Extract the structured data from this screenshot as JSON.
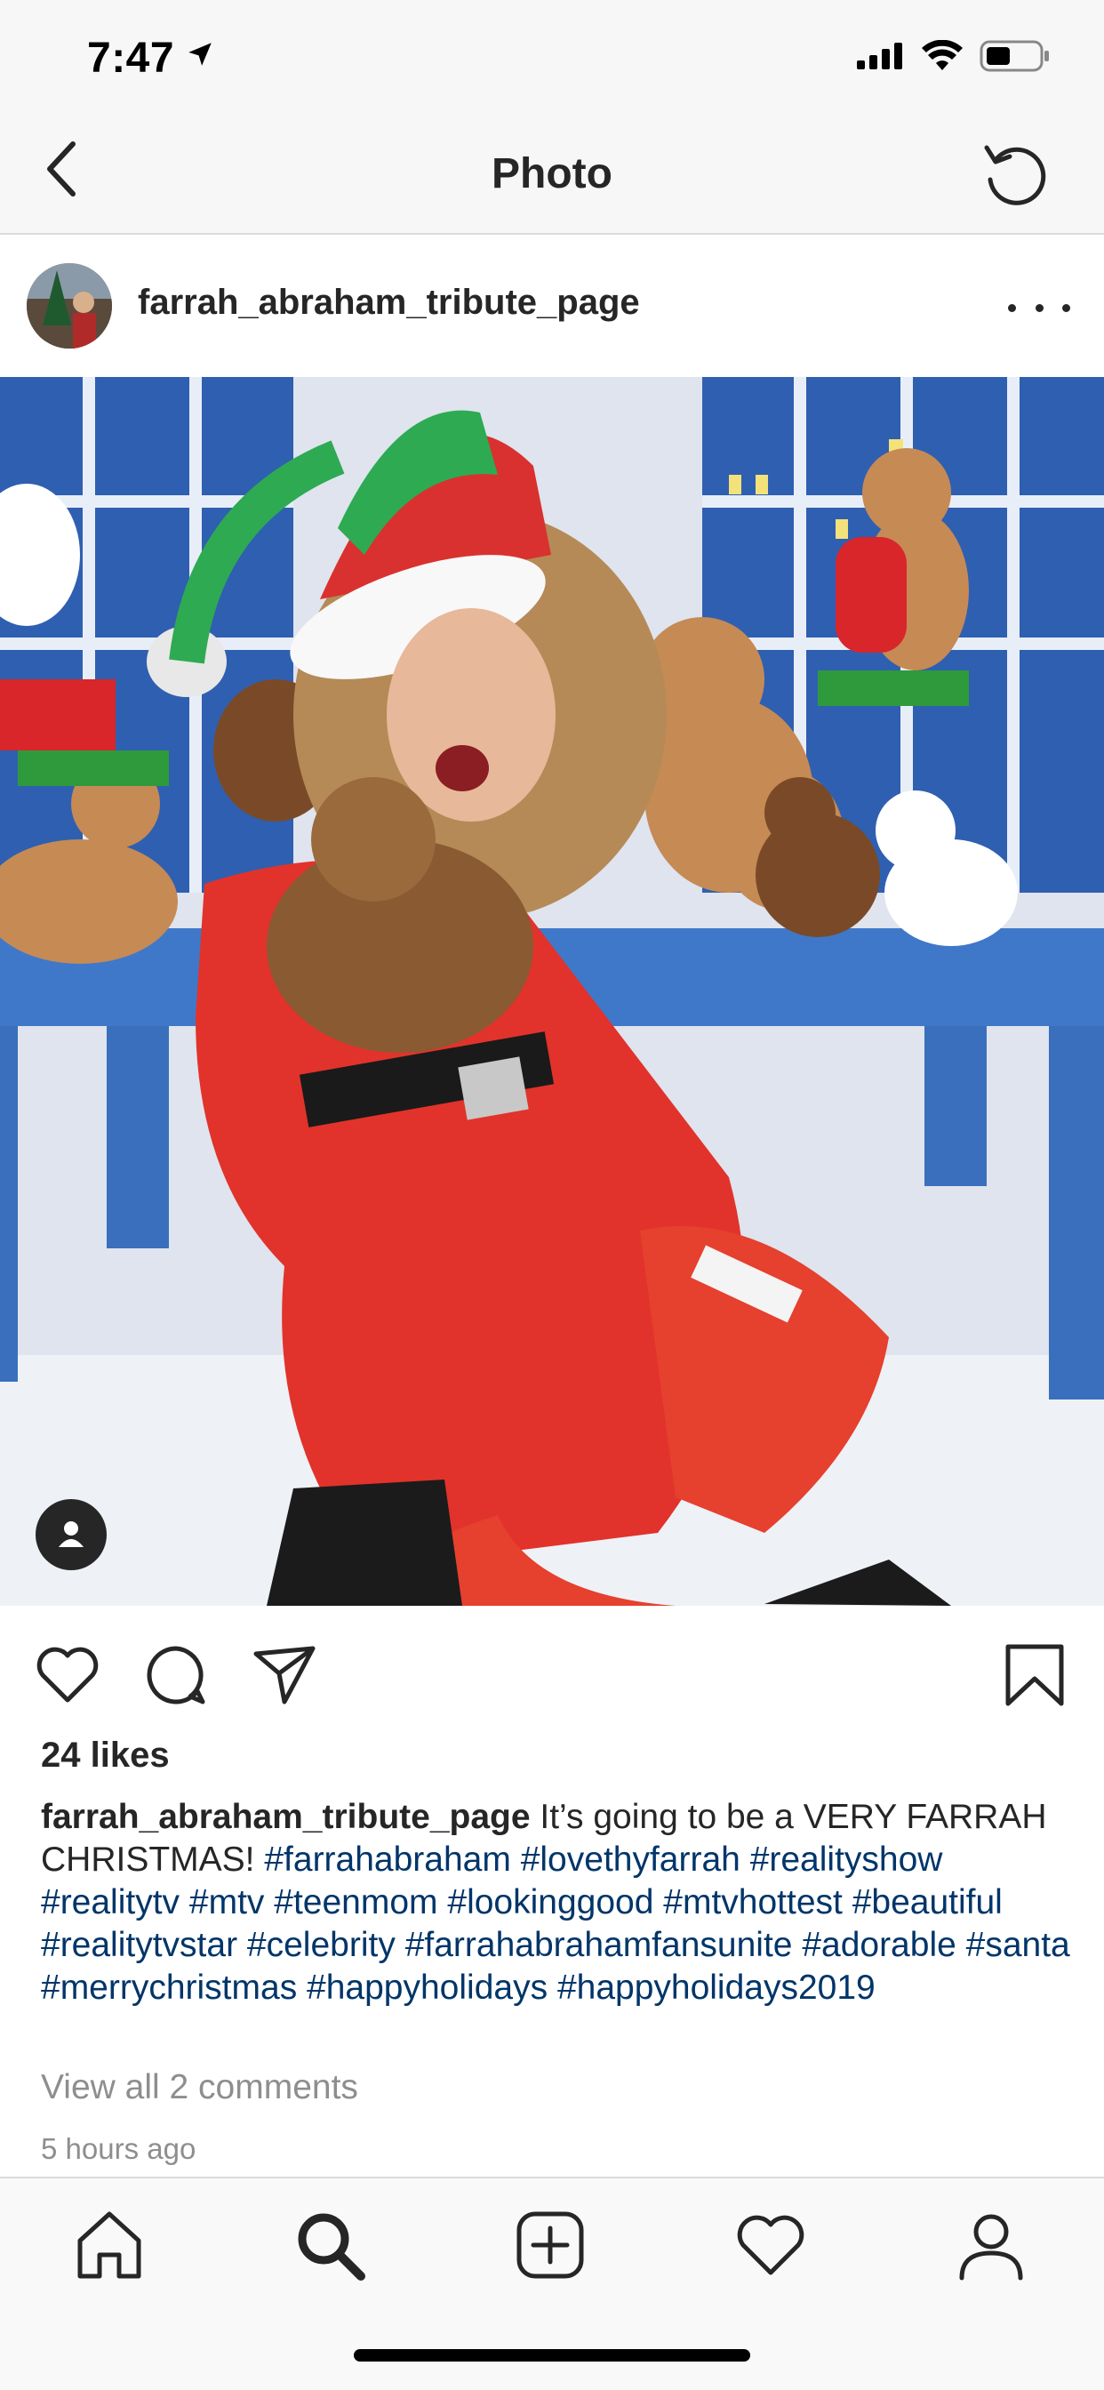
{
  "status_bar": {
    "time": "7:47",
    "icons": [
      "location-arrow-icon",
      "signal-icon",
      "wifi-icon",
      "battery-icon"
    ]
  },
  "nav": {
    "title": "Photo",
    "back_icon": "chevron-left-icon",
    "refresh_icon": "refresh-icon"
  },
  "post": {
    "username": "farrah_abraham_tribute_page",
    "more_icon": "more-horizontal-icon",
    "photo_alt": "Woman in red Santa dress and elf hat holding teddy bear, surrounded by teddy bears",
    "tag_icon": "user-tag-icon",
    "likes": "24 likes",
    "caption_user": "farrah_abraham_tribute_page",
    "caption_text": " It’s going to be a VERY FARRAH CHRISTMAS!  ",
    "hashtags": [
      "#farrahabraham",
      "#lovethyfarrah",
      "#realityshow",
      "#realitytv",
      "#mtv",
      "#teenmom",
      "#lookinggood",
      "#mtvhottest",
      "#beautiful",
      "#realitytvstar",
      "#celebrity",
      "#farrahabrahamfansunite",
      "#adorable",
      "#santa",
      "#merrychristmas",
      "#happyholidays",
      "#happyholidays2019"
    ],
    "view_comments": "View all 2 comments",
    "time_ago": "5 hours ago"
  },
  "actions": [
    "heart-icon",
    "comment-icon",
    "share-icon",
    "bookmark-icon"
  ],
  "tabbar": [
    "home-icon",
    "search-icon",
    "add-post-icon",
    "activity-heart-icon",
    "profile-icon"
  ],
  "colors": {
    "hashtag": "#003569",
    "text": "#262626",
    "muted": "#8e8e8e"
  }
}
